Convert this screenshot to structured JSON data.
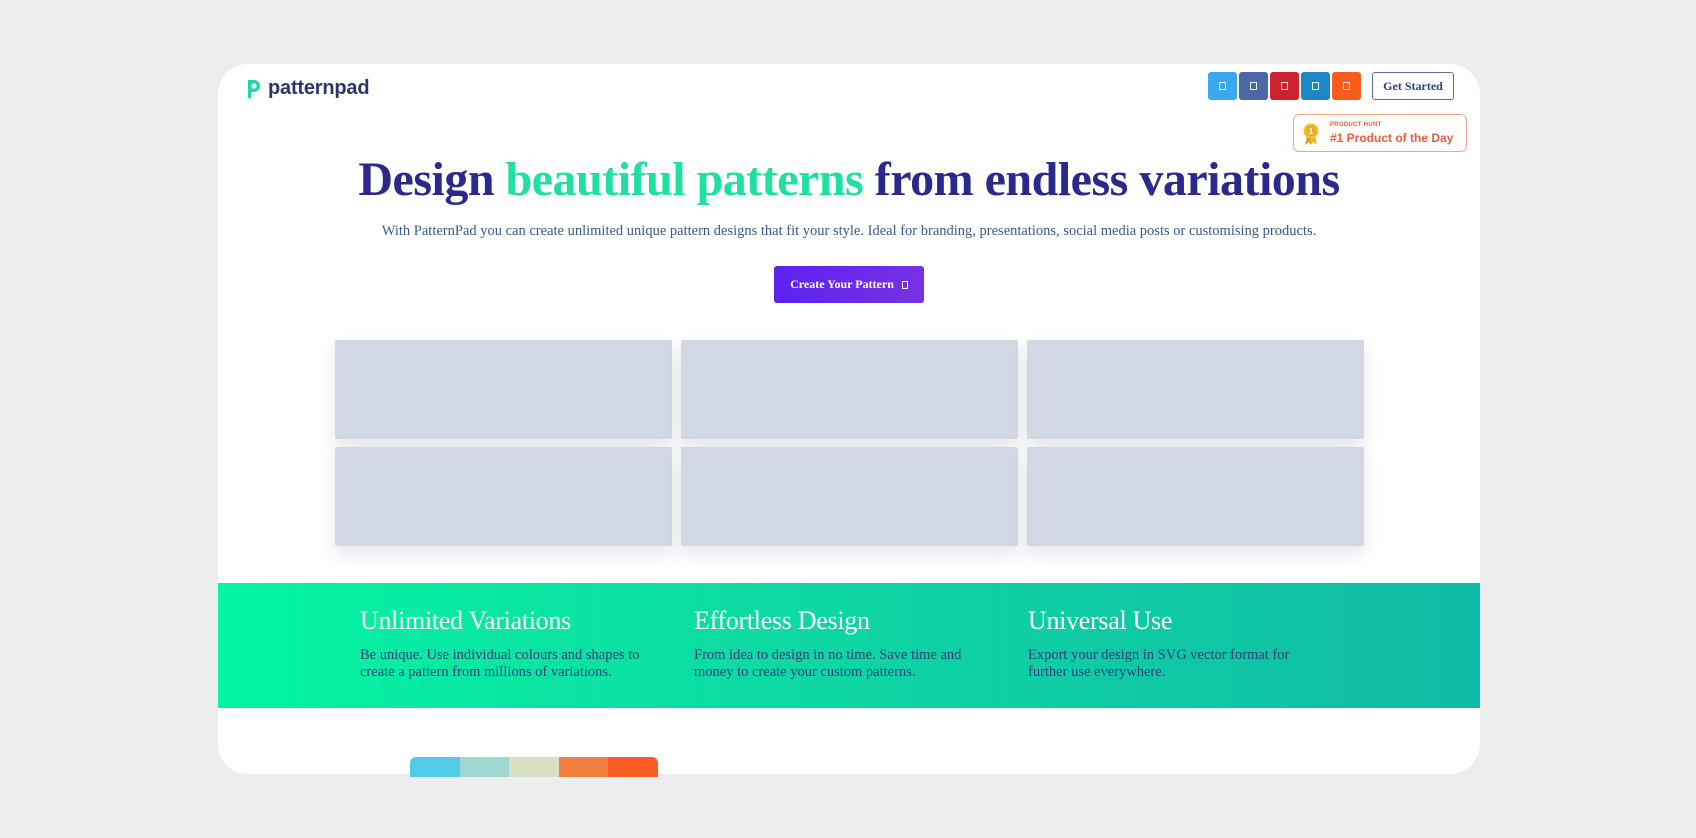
{
  "brand": {
    "name": "patternpad"
  },
  "share_buttons": [
    {
      "name": "twitter-share-button",
      "icon": "twitter-icon",
      "color": "#3aa7ee"
    },
    {
      "name": "facebook-share-button",
      "icon": "facebook-icon",
      "color": "#4c67a6"
    },
    {
      "name": "pinterest-share-button",
      "icon": "pinterest-icon",
      "color": "#cf2130"
    },
    {
      "name": "linkedin-share-button",
      "icon": "linkedin-icon",
      "color": "#1d86c4"
    },
    {
      "name": "reddit-share-button",
      "icon": "reddit-icon",
      "color": "#fb5a1e"
    }
  ],
  "header": {
    "get_started": "Get Started"
  },
  "product_hunt": {
    "small": "PRODUCT HUNT",
    "big": "#1 Product of the Day",
    "medal_number": "1",
    "color": "#ea5c3e"
  },
  "hero": {
    "title_start": "Design ",
    "title_accent": "beautiful patterns",
    "title_end": " from endless variations",
    "subtitle": "With PatternPad you can create unlimited unique pattern designs that fit your style. Ideal for branding, presentations, social media posts or customising products.",
    "cta": "Create Your Pattern"
  },
  "features": [
    {
      "title": "Unlimited Variations",
      "text": "Be unique. Use individual colours and shapes to create a pattern from millions of variations."
    },
    {
      "title": "Effortless Design",
      "text": "From idea to design in no time. Save time and money to create your custom patterns."
    },
    {
      "title": "Universal Use",
      "text": "Export your design in SVG vector format for further use everywhere."
    }
  ],
  "palette": [
    "#52cbe6",
    "#9ed8d1",
    "#d9dec5",
    "#f27f3d",
    "#fd5c22"
  ],
  "colors": {
    "accent": "#1ee0a0",
    "primary": "#2b2a8c",
    "cta": "#5b22ee"
  }
}
